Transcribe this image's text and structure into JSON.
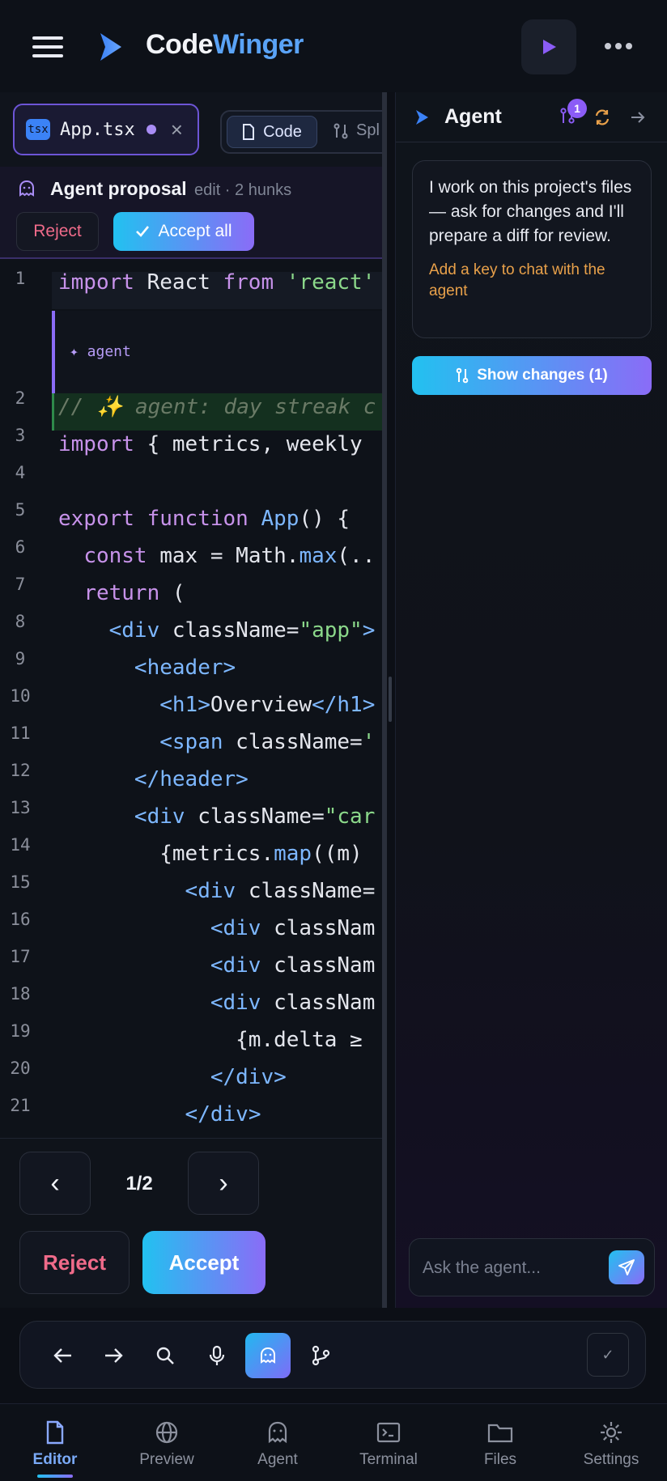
{
  "header": {
    "brand_part1": "Code",
    "brand_part2": "Winger",
    "colors": {
      "accent_blue": "#5aa3f6",
      "accent_purple": "#8b5cf6"
    }
  },
  "editor": {
    "file_tab": {
      "badge": "tsx",
      "name": "App.tsx"
    },
    "view_modes": {
      "code": "Code",
      "split": "Spl"
    },
    "proposal": {
      "title": "Agent proposal",
      "meta": "edit · 2 hunks",
      "reject": "Reject",
      "accept_all": "Accept all"
    },
    "inline_widget": "✦ agent",
    "hunk_nav": {
      "counter": "1/2",
      "prev": "‹",
      "next": "›",
      "reject": "Reject",
      "accept": "Accept"
    }
  },
  "code_lines": [
    {
      "n": "1",
      "indent": "",
      "parts": [
        [
          "kw",
          "import"
        ],
        [
          "",
          " React "
        ],
        [
          "kw",
          "from"
        ],
        [
          "",
          " "
        ],
        [
          "str",
          "'react'"
        ]
      ]
    },
    {
      "n": "2",
      "indent": "",
      "parts": [
        [
          "cm",
          "// ✨ agent: day streak c"
        ]
      ]
    },
    {
      "n": "3",
      "indent": "",
      "parts": [
        [
          "kw",
          "import"
        ],
        [
          "",
          " { metrics, weekly"
        ]
      ]
    },
    {
      "n": "4",
      "indent": "",
      "parts": []
    },
    {
      "n": "5",
      "indent": "",
      "parts": [
        [
          "kw",
          "export"
        ],
        [
          "",
          " "
        ],
        [
          "kw",
          "function"
        ],
        [
          "",
          " "
        ],
        [
          "fn",
          "App"
        ],
        [
          "",
          "() {"
        ]
      ]
    },
    {
      "n": "6",
      "indent": "  ",
      "parts": [
        [
          "kw",
          "const"
        ],
        [
          "",
          " max = Math."
        ],
        [
          "fn",
          "max"
        ],
        [
          "",
          "(.."
        ]
      ]
    },
    {
      "n": "7",
      "indent": "  ",
      "parts": [
        [
          "kw",
          "return"
        ],
        [
          "",
          " ("
        ]
      ]
    },
    {
      "n": "8",
      "indent": "    ",
      "parts": [
        [
          "tag",
          "<div"
        ],
        [
          "",
          " className="
        ],
        [
          "str",
          "\"app\""
        ],
        [
          "tag",
          ">"
        ]
      ]
    },
    {
      "n": "9",
      "indent": "      ",
      "parts": [
        [
          "tag",
          "<header>"
        ]
      ]
    },
    {
      "n": "10",
      "indent": "        ",
      "parts": [
        [
          "tag",
          "<h1>"
        ],
        [
          "",
          "Overview"
        ],
        [
          "tag",
          "</h1>"
        ]
      ]
    },
    {
      "n": "11",
      "indent": "        ",
      "parts": [
        [
          "tag",
          "<span"
        ],
        [
          "",
          " className="
        ],
        [
          "str",
          "'"
        ]
      ]
    },
    {
      "n": "12",
      "indent": "      ",
      "parts": [
        [
          "tag",
          "</header>"
        ]
      ]
    },
    {
      "n": "13",
      "indent": "      ",
      "parts": [
        [
          "tag",
          "<div"
        ],
        [
          "",
          " className="
        ],
        [
          "str",
          "\"car"
        ]
      ]
    },
    {
      "n": "14",
      "indent": "        ",
      "parts": [
        [
          "",
          "{metrics."
        ],
        [
          "fn",
          "map"
        ],
        [
          "",
          "((m)"
        ]
      ]
    },
    {
      "n": "15",
      "indent": "          ",
      "parts": [
        [
          "tag",
          "<div"
        ],
        [
          "",
          " className="
        ]
      ]
    },
    {
      "n": "16",
      "indent": "            ",
      "parts": [
        [
          "tag",
          "<div"
        ],
        [
          "",
          " classNam"
        ]
      ]
    },
    {
      "n": "17",
      "indent": "            ",
      "parts": [
        [
          "tag",
          "<div"
        ],
        [
          "",
          " classNam"
        ]
      ]
    },
    {
      "n": "18",
      "indent": "            ",
      "parts": [
        [
          "tag",
          "<div"
        ],
        [
          "",
          " classNam"
        ]
      ]
    },
    {
      "n": "19",
      "indent": "              ",
      "parts": [
        [
          "",
          "{m.delta ≥"
        ]
      ]
    },
    {
      "n": "20",
      "indent": "            ",
      "parts": [
        [
          "tag",
          "</div>"
        ]
      ]
    },
    {
      "n": "21",
      "indent": "          ",
      "parts": [
        [
          "tag",
          "</div>"
        ]
      ]
    }
  ],
  "agent_panel": {
    "title": "Agent",
    "badge_count": "1",
    "message": "I work on this project's files — ask for changes and I'll prepare a diff for review.",
    "warning": "Add a key to chat with the agent",
    "show_changes": "Show changes (1)",
    "ask_placeholder": "Ask the agent..."
  },
  "toolbar": {
    "tools": [
      "back-icon",
      "forward-icon",
      "search-icon",
      "microphone-icon",
      "agent-chat-icon",
      "git-branch-icon"
    ],
    "check": "✓"
  },
  "bottom_nav": [
    {
      "label": "Editor",
      "icon": "file-icon"
    },
    {
      "label": "Preview",
      "icon": "globe-icon"
    },
    {
      "label": "Agent",
      "icon": "agent-icon"
    },
    {
      "label": "Terminal",
      "icon": "terminal-icon"
    },
    {
      "label": "Files",
      "icon": "folder-icon"
    },
    {
      "label": "Settings",
      "icon": "gear-icon"
    }
  ]
}
